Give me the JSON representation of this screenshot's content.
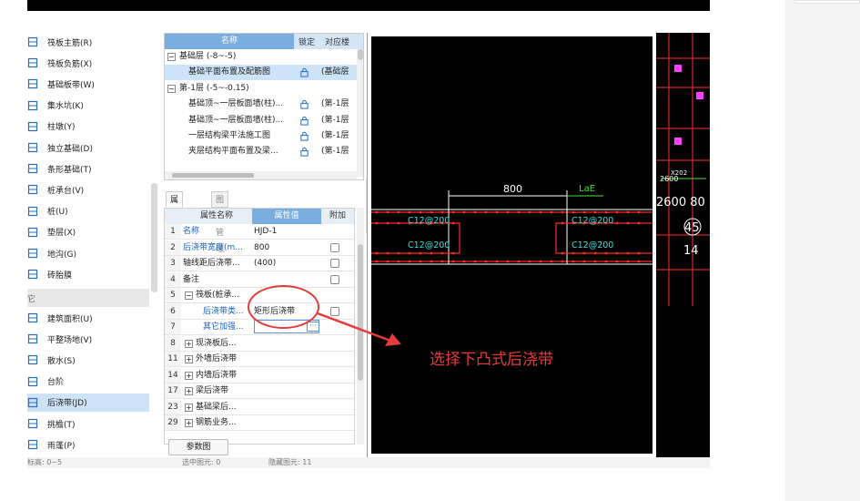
{
  "component_list": [
    {
      "label": "筏板主筋(R)",
      "icon": "raft-main-rebar-icon"
    },
    {
      "label": "筏板负筋(X)",
      "icon": "raft-negative-rebar-icon"
    },
    {
      "label": "基础板带(W)",
      "icon": "foundation-strip-icon"
    },
    {
      "label": "集水坑(K)",
      "icon": "sump-pit-icon"
    },
    {
      "label": "柱墩(Y)",
      "icon": "column-pier-icon"
    },
    {
      "label": "独立基础(D)",
      "icon": "isolated-footing-icon"
    },
    {
      "label": "条形基础(T)",
      "icon": "strip-footing-icon"
    },
    {
      "label": "桩承台(V)",
      "icon": "pile-cap-icon"
    },
    {
      "label": "桩(U)",
      "icon": "pile-icon"
    },
    {
      "label": "垫层(X)",
      "icon": "cushion-layer-icon"
    },
    {
      "label": "地沟(G)",
      "icon": "trench-icon"
    },
    {
      "label": "砖胎膜",
      "icon": "brick-mold-icon"
    }
  ],
  "component_group_label": "它",
  "component_list_2": [
    {
      "label": "建筑面积(U)",
      "icon": "building-area-icon",
      "selected": false
    },
    {
      "label": "平整场地(V)",
      "icon": "site-leveling-icon",
      "selected": false
    },
    {
      "label": "散水(S)",
      "icon": "apron-icon",
      "selected": false
    },
    {
      "label": "台阶",
      "icon": "steps-icon",
      "selected": false
    },
    {
      "label": "后浇带(JD)",
      "icon": "post-cast-strip-icon",
      "selected": true
    },
    {
      "label": "挑檐(T)",
      "icon": "cornice-icon",
      "selected": false
    },
    {
      "label": "雨蓬(P)",
      "icon": "canopy-icon",
      "selected": false
    }
  ],
  "floor_panel": {
    "col_name": "名称",
    "col_lock": "锁定",
    "col_map": "对应楼",
    "rows": [
      {
        "name": "基础层 (-8~-5)",
        "level": 0,
        "toggle": "−",
        "lock": false,
        "map": ""
      },
      {
        "name": "基础平面布置及配筋图",
        "level": 1,
        "toggle": "",
        "lock": true,
        "map": "(基础层",
        "selected": true
      },
      {
        "name": "第-1层 (-5~-0.15)",
        "level": 0,
        "toggle": "−",
        "lock": false,
        "map": ""
      },
      {
        "name": "基础顶~一层板面墙(柱)...",
        "level": 1,
        "toggle": "",
        "lock": true,
        "map": "(第-1层"
      },
      {
        "name": "基础顶~一层板面墙(柱)...",
        "level": 1,
        "toggle": "",
        "lock": true,
        "map": "(第-1层"
      },
      {
        "name": "一层结构梁平法施工图",
        "level": 1,
        "toggle": "",
        "lock": true,
        "map": "(第-1层"
      },
      {
        "name": "夹层结构平面布置及梁...",
        "level": 1,
        "toggle": "",
        "lock": true,
        "map": "(第-1层"
      }
    ]
  },
  "prop_panel": {
    "tab_props": "属性列表",
    "tab_layers": "图层管理",
    "col_name": "属性名称",
    "col_value": "属性值",
    "col_extra": "附加",
    "rows": [
      {
        "num": "1",
        "name": "名称",
        "value": "HJD-1",
        "blue": true,
        "check": false,
        "toggle": ""
      },
      {
        "num": "2",
        "name": "后浇带宽度(m...",
        "value": "800",
        "blue": true,
        "check": true,
        "toggle": ""
      },
      {
        "num": "3",
        "name": "轴线距后浇带...",
        "value": "(400)",
        "blue": false,
        "check": true,
        "toggle": ""
      },
      {
        "num": "4",
        "name": "备注",
        "value": "",
        "blue": false,
        "check": true,
        "toggle": ""
      },
      {
        "num": "5",
        "name": "筏板(桩承...",
        "value": "",
        "blue": false,
        "check": false,
        "toggle": "−"
      },
      {
        "num": "6",
        "name": "后浇带类...",
        "value": "矩形后浇带",
        "blue": true,
        "check": true,
        "toggle": ""
      },
      {
        "num": "7",
        "name": "其它加强...",
        "value": "",
        "blue": true,
        "check": false,
        "toggle": "",
        "editing": true
      },
      {
        "num": "8",
        "name": "现浇板后...",
        "value": "",
        "blue": false,
        "check": false,
        "toggle": "+"
      },
      {
        "num": "11",
        "name": "外墙后浇带",
        "value": "",
        "blue": false,
        "check": false,
        "toggle": "+"
      },
      {
        "num": "14",
        "name": "内墙后浇带",
        "value": "",
        "blue": false,
        "check": false,
        "toggle": "+"
      },
      {
        "num": "17",
        "name": "梁后浇带",
        "value": "",
        "blue": false,
        "check": false,
        "toggle": "+"
      },
      {
        "num": "23",
        "name": "基础梁后...",
        "value": "",
        "blue": false,
        "check": false,
        "toggle": "+"
      },
      {
        "num": "29",
        "name": "钢筋业务...",
        "value": "",
        "blue": false,
        "check": false,
        "toggle": "+"
      }
    ],
    "param_button": "参数图",
    "ellipsis": "···"
  },
  "drawing": {
    "dim_width": "800",
    "dim_lae": "LaE",
    "rebar_labels": [
      "C12@200",
      "C12@200",
      "C12@200",
      "C12@200"
    ]
  },
  "cad_bg": {
    "labels": [
      "2600",
      "2600 80",
      "45",
      "14",
      "X202"
    ]
  },
  "annotation": {
    "text": "选择下凸式后浇带"
  },
  "status": {
    "texts": [
      "标高: 0~5",
      "选中图元: 0",
      "隐藏图元: 11"
    ]
  },
  "colors": {
    "selection": "#cde3f7",
    "header_blue": "#7aaee0",
    "annotation_red": "#e63b3b",
    "cad_red": "#ff2b2b",
    "cad_cyan": "#38e0e0",
    "cad_green": "#3fe03f"
  }
}
